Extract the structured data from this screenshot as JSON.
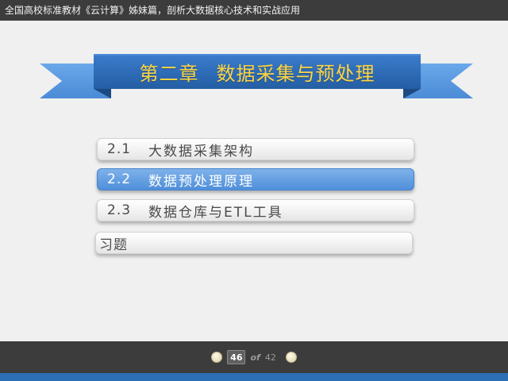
{
  "header": {
    "title": "全国高校标准教材《云计算》姊妹篇，剖析大数据核心技术和实战应用"
  },
  "banner": {
    "chapter": "第二章",
    "title": "数据采集与预处理"
  },
  "menu": {
    "items": [
      {
        "num": "2.1",
        "label": "大数据采集架构",
        "active": false
      },
      {
        "num": "2.2",
        "label": "数据预处理原理",
        "active": true
      },
      {
        "num": "2.3",
        "label": "数据仓库与ETL工具",
        "active": false
      }
    ],
    "exercise": {
      "label": "习题"
    }
  },
  "pager": {
    "current": "46",
    "of": "of",
    "total": "42"
  },
  "colors": {
    "ribbon_main": "#2f6db5",
    "ribbon_tail": "#5a9be0",
    "title_yellow": "#ffd540",
    "active_item": "#5b97de",
    "dark_bar": "#3c3c3c"
  },
  "icons": {
    "prev": "prev-page-icon",
    "next": "next-page-icon"
  }
}
